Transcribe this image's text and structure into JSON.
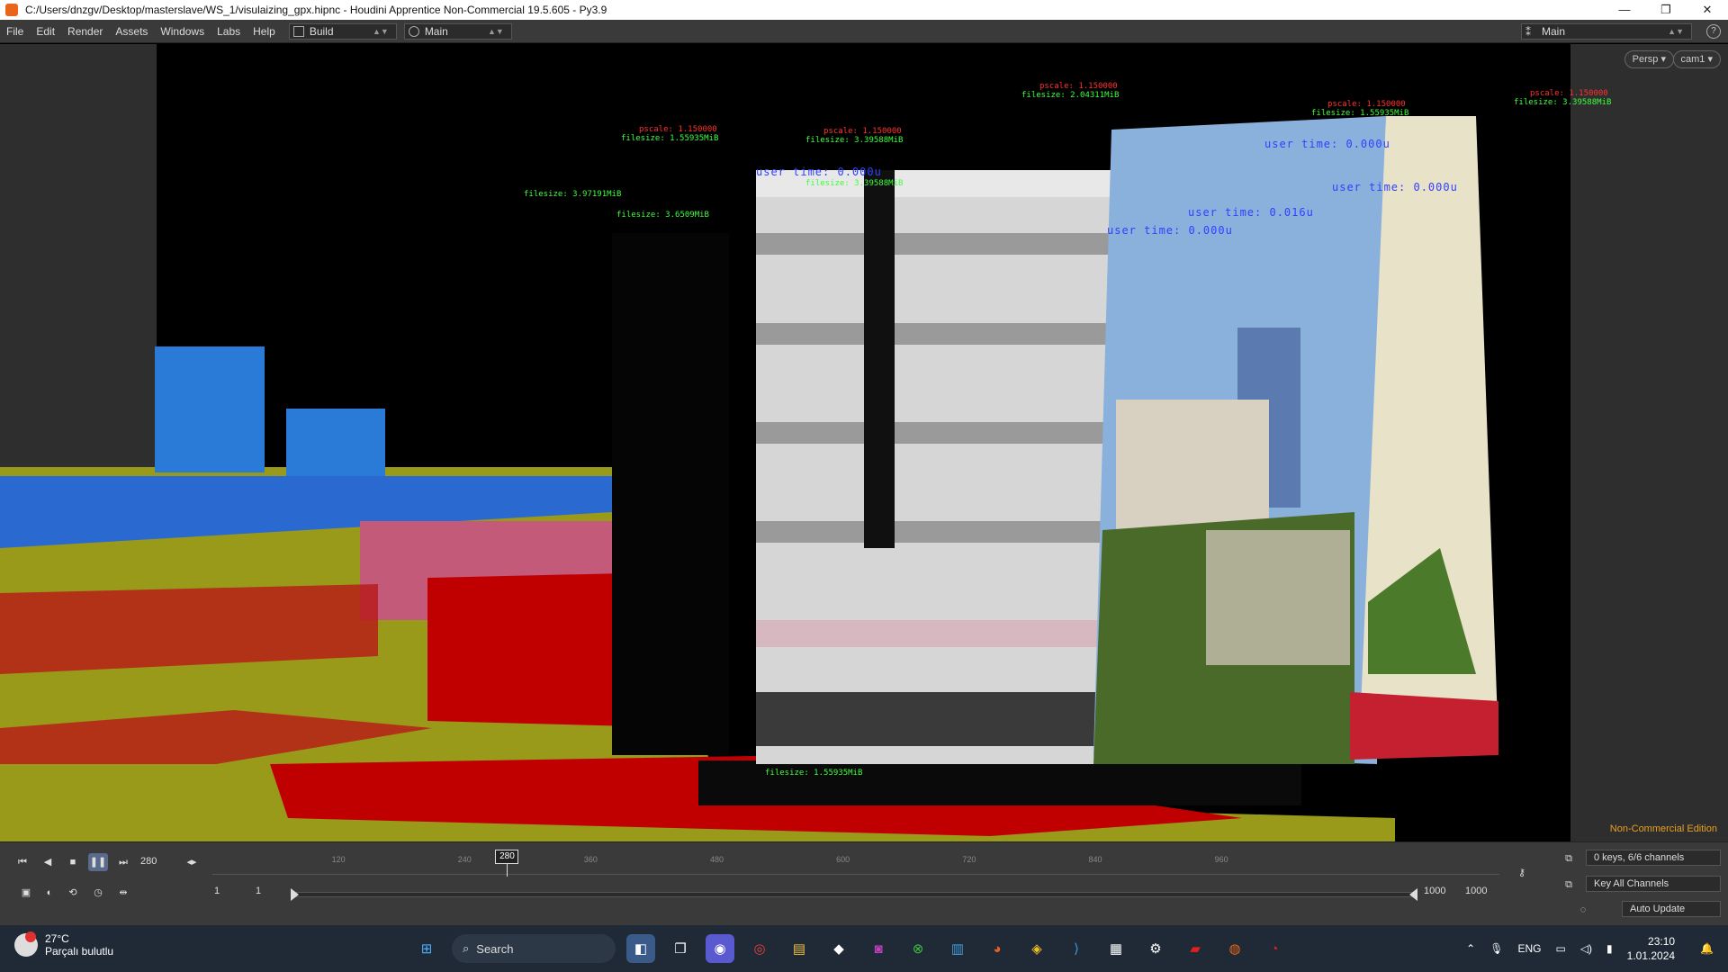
{
  "window": {
    "title": "C:/Users/dnzgv/Desktop/masterslave/WS_1/visulaizing_gpx.hipnc - Houdini Apprentice Non-Commercial 19.5.605 - Py3.9",
    "controls": [
      "—",
      "❐",
      "✕"
    ]
  },
  "menubar": {
    "items": [
      "File",
      "Edit",
      "Render",
      "Assets",
      "Windows",
      "Labs",
      "Help"
    ],
    "desktop_build": "Build",
    "desktop_main": "Main",
    "right_desktop": "Main"
  },
  "viewport": {
    "persp_label": "Persp ▾",
    "cam_label": "cam1 ▾",
    "edition_label": "Non-Commercial Edition",
    "overlays": {
      "red": [
        "pscale: 1.150000",
        "pscale: 1.150000",
        "pscale: 1.150000",
        "pscale: 1.150000",
        "pscale: 1.150000"
      ],
      "green": [
        "filesize: 1.55935MiB",
        "filesize: 3.39588MiB",
        "filesize: 2.04311MiB",
        "filesize: 1.55935MiB",
        "filesize: 3.39588MiB",
        "filesize: 3.39588MiB",
        "filesize: 3.97191MiB",
        "filesize: 3.6509MiB",
        "filesize: 1.55935MiB"
      ],
      "blue": [
        "user time: 0.000u",
        "user time: 0.000u",
        "user time: 0.000u",
        "user time: 0.016u",
        "user time: 0.000u"
      ]
    }
  },
  "playbar": {
    "current_frame": "280",
    "start_frame": "1",
    "start_frame2": "1",
    "end_frame": "1000",
    "end_frame2": "1000",
    "ticks": [
      "120",
      "240",
      "360",
      "480",
      "600",
      "720",
      "840",
      "960"
    ],
    "marker_frame": "280",
    "keys_info": "0 keys, 6/6 channels",
    "key_all": "Key All Channels",
    "auto_update": "Auto Update"
  },
  "taskbar": {
    "temperature": "27°C",
    "weather_desc": "Parçalı bulutlu",
    "search_placeholder": "Search",
    "language": "ENG",
    "time": "23:10",
    "date": "1.01.2024"
  }
}
